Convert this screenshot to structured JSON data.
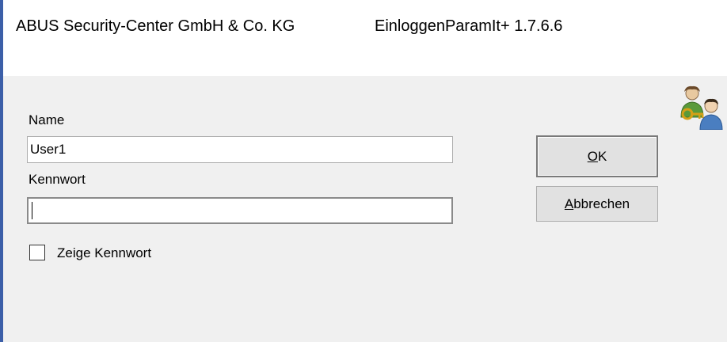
{
  "window": {
    "title_company": "ABUS Security-Center GmbH & Co. KG",
    "title_app": "EinloggenParamIt+ 1.7.6.6"
  },
  "form": {
    "name_label": "Name",
    "name_value": "User1",
    "password_label": "Kennwort",
    "password_value": "",
    "show_password_label": "Zeige Kennwort",
    "show_password_checked": false
  },
  "buttons": {
    "ok_label": "OK",
    "cancel_label": "Abbrechen"
  },
  "icons": {
    "users_key": "users-key-icon"
  },
  "colors": {
    "dialog_background": "#f0f0f0",
    "title_background": "#ffffff",
    "button_face": "#e1e1e1",
    "window_edge": "#3c5fa8"
  }
}
